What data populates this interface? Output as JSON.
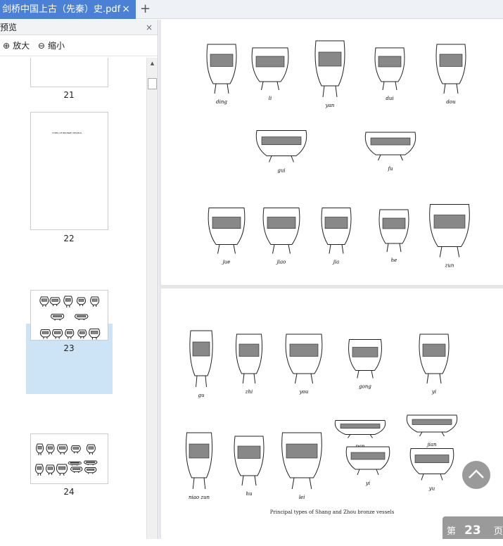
{
  "tab": {
    "title": "剑桥中国上古（先秦）史.pdf",
    "close": "×",
    "new_tab": "+"
  },
  "sidebar": {
    "title": "预览",
    "close": "×",
    "zoom_in": "放大",
    "zoom_out": "缩小",
    "thumbnails": [
      {
        "page": "21"
      },
      {
        "page": "22",
        "text": "TYPES OF BRONZE VESSELS"
      },
      {
        "page": "23",
        "selected": true
      },
      {
        "page": "24"
      }
    ]
  },
  "pages": [
    {
      "vessels": [
        "ding",
        "li",
        "yan",
        "dui",
        "dou",
        "gui",
        "fu",
        "jue",
        "jiao",
        "jia",
        "he",
        "zun"
      ]
    },
    {
      "vessels": [
        "gu",
        "zhi",
        "you",
        "gong",
        "yi",
        "pan",
        "jian",
        "niao zun",
        "hu",
        "lei",
        "yi",
        "yu"
      ],
      "caption": "Principal types of Shang and Zhou bronze vessels"
    }
  ],
  "page_indicator": {
    "prefix": "第",
    "current": "23",
    "suffix": "页"
  }
}
